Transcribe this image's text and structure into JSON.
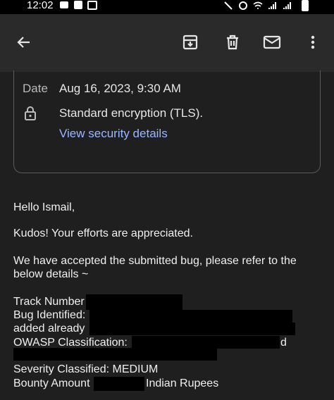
{
  "status_bar": {
    "time": "12:02"
  },
  "details": {
    "date_label": "Date",
    "date_value": "Aug 16, 2023, 9:30 AM",
    "encryption": "Standard encryption (TLS).",
    "security_link": "View security details"
  },
  "email": {
    "greeting": "Hello Ismail,",
    "kudos": "Kudos! Your efforts are appreciated.",
    "accepted_line1": "We have accepted the submitted bug, please refer to the",
    "accepted_line2": "below details ~",
    "track_number": "Track Number",
    "bug_identified": "Bug Identified:",
    "added_already": "added already",
    "owasp": "OWASP Classification:",
    "owasp_trailing": "d",
    "severity": "Severity Classified: MEDIUM",
    "bounty_amount": "Bounty Amount",
    "bounty_currency": "Indian Rupees"
  },
  "icons": [
    "back-arrow-icon",
    "archive-icon",
    "delete-icon",
    "mail-icon",
    "more-vert-icon",
    "lock-icon"
  ]
}
